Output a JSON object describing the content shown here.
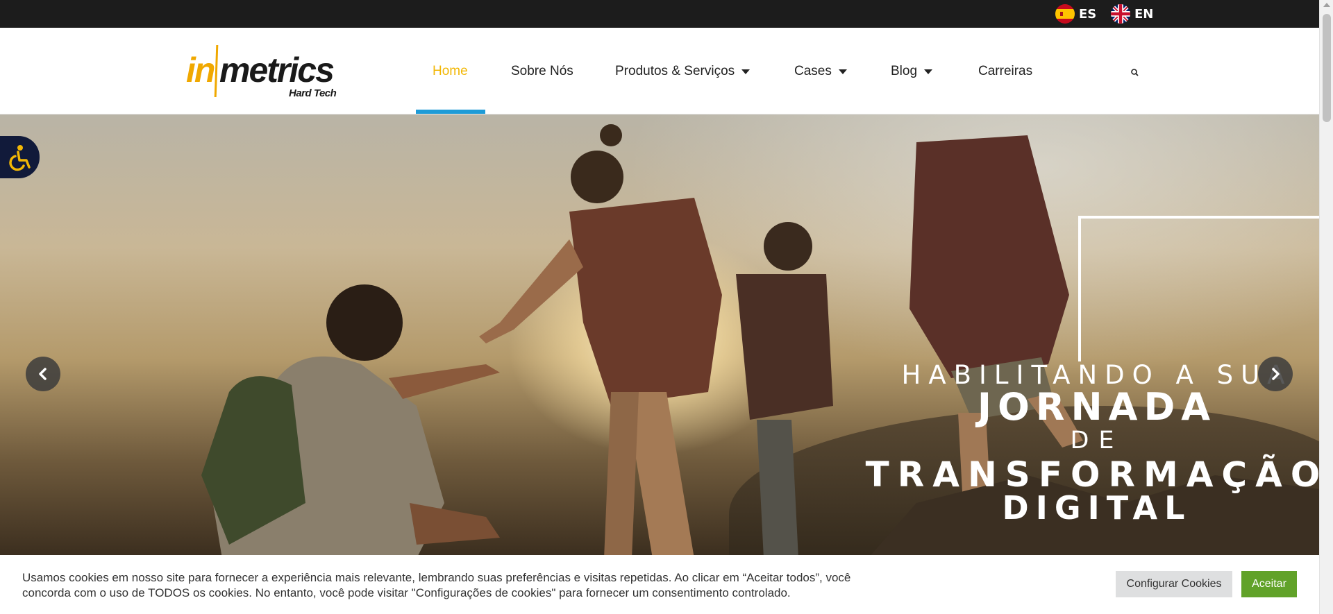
{
  "languages": [
    {
      "code": "ES",
      "flag_icon": "spain-flag-icon"
    },
    {
      "code": "EN",
      "flag_icon": "uk-flag-icon"
    }
  ],
  "logo": {
    "prefix": "in",
    "main": "metrics",
    "tagline": "Hard Tech",
    "colors": {
      "accent": "#f0a800",
      "dark": "#1a1a1a"
    }
  },
  "nav": {
    "items": [
      {
        "label": "Home",
        "active": true,
        "has_dropdown": false
      },
      {
        "label": "Sobre Nós",
        "active": false,
        "has_dropdown": false
      },
      {
        "label": "Produtos & Serviços",
        "active": false,
        "has_dropdown": true
      },
      {
        "label": "Cases",
        "active": false,
        "has_dropdown": true
      },
      {
        "label": "Blog",
        "active": false,
        "has_dropdown": true
      },
      {
        "label": "Carreiras",
        "active": false,
        "has_dropdown": false
      }
    ],
    "active_color": "#f2b705",
    "underline_color": "#1e9bd7",
    "search_icon": "search-icon"
  },
  "hero": {
    "line1": "HABILITANDO A SUA",
    "line2": "JORNADA",
    "line3": "DE",
    "line4": "TRANSFORMAÇÃO",
    "line5": "DIGITAL",
    "prev_icon": "chevron-left-icon",
    "next_icon": "chevron-right-icon"
  },
  "accessibility": {
    "icon": "accessibility-icon",
    "color": "#f2b705"
  },
  "cookie": {
    "text_line1": "Usamos cookies em nosso site para fornecer a experiência mais relevante, lembrando suas preferências e visitas repetidas. Ao clicar em “Aceitar todos”, você",
    "text_line2": "concorda com o uso de TODOS os cookies. No entanto, você pode visitar \"Configurações de cookies\" para fornecer um consentimento controlado.",
    "config_label": "Configurar Cookies",
    "accept_label": "Aceitar",
    "accept_color": "#61a229"
  }
}
